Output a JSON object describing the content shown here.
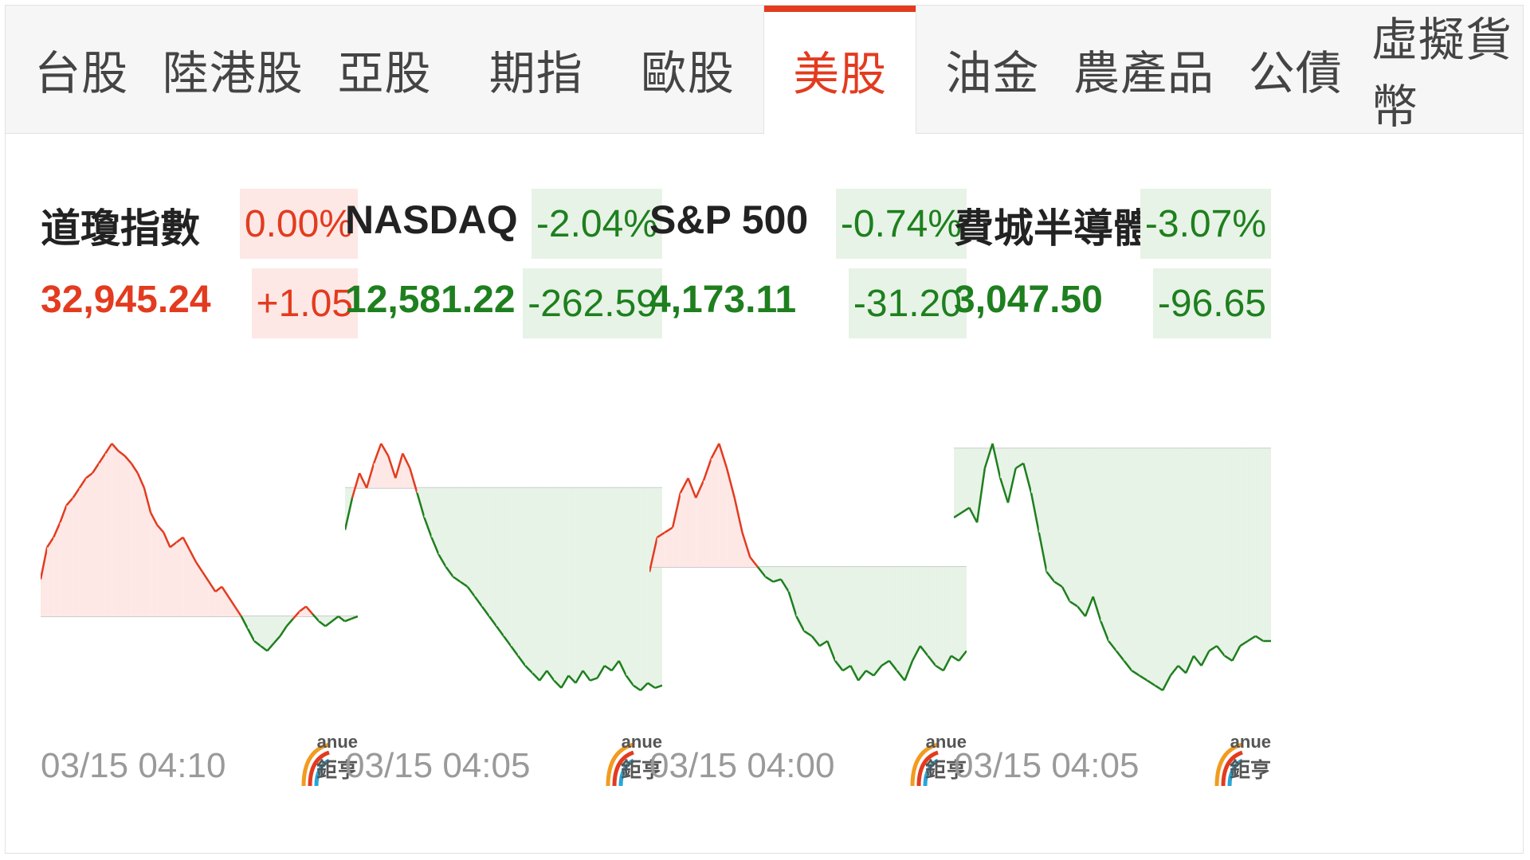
{
  "tabs": [
    {
      "label": "台股",
      "active": false
    },
    {
      "label": "陸港股",
      "active": false
    },
    {
      "label": "亞股",
      "active": false
    },
    {
      "label": "期指",
      "active": false
    },
    {
      "label": "歐股",
      "active": false
    },
    {
      "label": "美股",
      "active": true
    },
    {
      "label": "油金",
      "active": false
    },
    {
      "label": "農產品",
      "active": false
    },
    {
      "label": "公債",
      "active": false
    },
    {
      "label": "虛擬貨幣",
      "active": false
    }
  ],
  "colors": {
    "up": "#e33b1f",
    "down": "#1e7f1e",
    "up_fill": "#fde8e6",
    "down_fill": "#e7f3e6",
    "baseline": "#cccccc"
  },
  "logo": {
    "line1": "anue",
    "line2": "鉅亨"
  },
  "indices": [
    {
      "name": "道瓊指數",
      "percent": "0.00%",
      "price": "32,945.24",
      "change": "+1.05",
      "trend": "up",
      "time": "03/15 04:10",
      "baseline": 0.7,
      "series": [
        0.55,
        0.42,
        0.38,
        0.32,
        0.25,
        0.22,
        0.18,
        0.14,
        0.12,
        0.08,
        0.04,
        0.0,
        0.03,
        0.05,
        0.08,
        0.12,
        0.18,
        0.28,
        0.33,
        0.36,
        0.42,
        0.4,
        0.38,
        0.43,
        0.48,
        0.52,
        0.56,
        0.6,
        0.58,
        0.62,
        0.66,
        0.7,
        0.75,
        0.8,
        0.82,
        0.84,
        0.81,
        0.78,
        0.74,
        0.71,
        0.68,
        0.66,
        0.69,
        0.72,
        0.74,
        0.72,
        0.7,
        0.72,
        0.71,
        0.7
      ]
    },
    {
      "name": "NASDAQ",
      "percent": "-2.04%",
      "price": "12,581.22",
      "change": "-262.59",
      "trend": "down",
      "time": "03/15 04:05",
      "baseline": 0.18,
      "series": [
        0.35,
        0.22,
        0.12,
        0.18,
        0.08,
        0.0,
        0.05,
        0.14,
        0.04,
        0.1,
        0.2,
        0.3,
        0.38,
        0.45,
        0.5,
        0.54,
        0.56,
        0.58,
        0.62,
        0.66,
        0.7,
        0.74,
        0.78,
        0.82,
        0.86,
        0.9,
        0.93,
        0.96,
        0.92,
        0.96,
        0.99,
        0.94,
        0.97,
        0.92,
        0.96,
        0.95,
        0.9,
        0.92,
        0.88,
        0.94,
        0.98,
        1.0,
        0.97,
        0.99,
        0.98
      ]
    },
    {
      "name": "S&P 500",
      "percent": "-0.74%",
      "price": "4,173.11",
      "change": "-31.20",
      "trend": "down",
      "time": "03/15 04:00",
      "baseline": 0.5,
      "series": [
        0.52,
        0.38,
        0.36,
        0.34,
        0.2,
        0.14,
        0.22,
        0.15,
        0.06,
        0.0,
        0.1,
        0.22,
        0.36,
        0.46,
        0.5,
        0.54,
        0.56,
        0.55,
        0.6,
        0.7,
        0.76,
        0.78,
        0.82,
        0.8,
        0.88,
        0.92,
        0.9,
        0.96,
        0.92,
        0.94,
        0.9,
        0.88,
        0.92,
        0.96,
        0.88,
        0.82,
        0.86,
        0.9,
        0.92,
        0.86,
        0.88,
        0.84
      ]
    },
    {
      "name": "費城半導體",
      "percent": "-3.07%",
      "price": "3,047.50",
      "change": "-96.65",
      "trend": "down",
      "time": "03/15 04:05",
      "baseline": 0.02,
      "series": [
        0.3,
        0.28,
        0.26,
        0.32,
        0.1,
        0.0,
        0.14,
        0.24,
        0.1,
        0.08,
        0.2,
        0.36,
        0.52,
        0.56,
        0.58,
        0.64,
        0.66,
        0.7,
        0.62,
        0.72,
        0.8,
        0.84,
        0.88,
        0.92,
        0.94,
        0.96,
        0.98,
        1.0,
        0.94,
        0.9,
        0.93,
        0.86,
        0.9,
        0.84,
        0.82,
        0.86,
        0.88,
        0.82,
        0.8,
        0.78,
        0.8,
        0.8
      ]
    }
  ]
}
